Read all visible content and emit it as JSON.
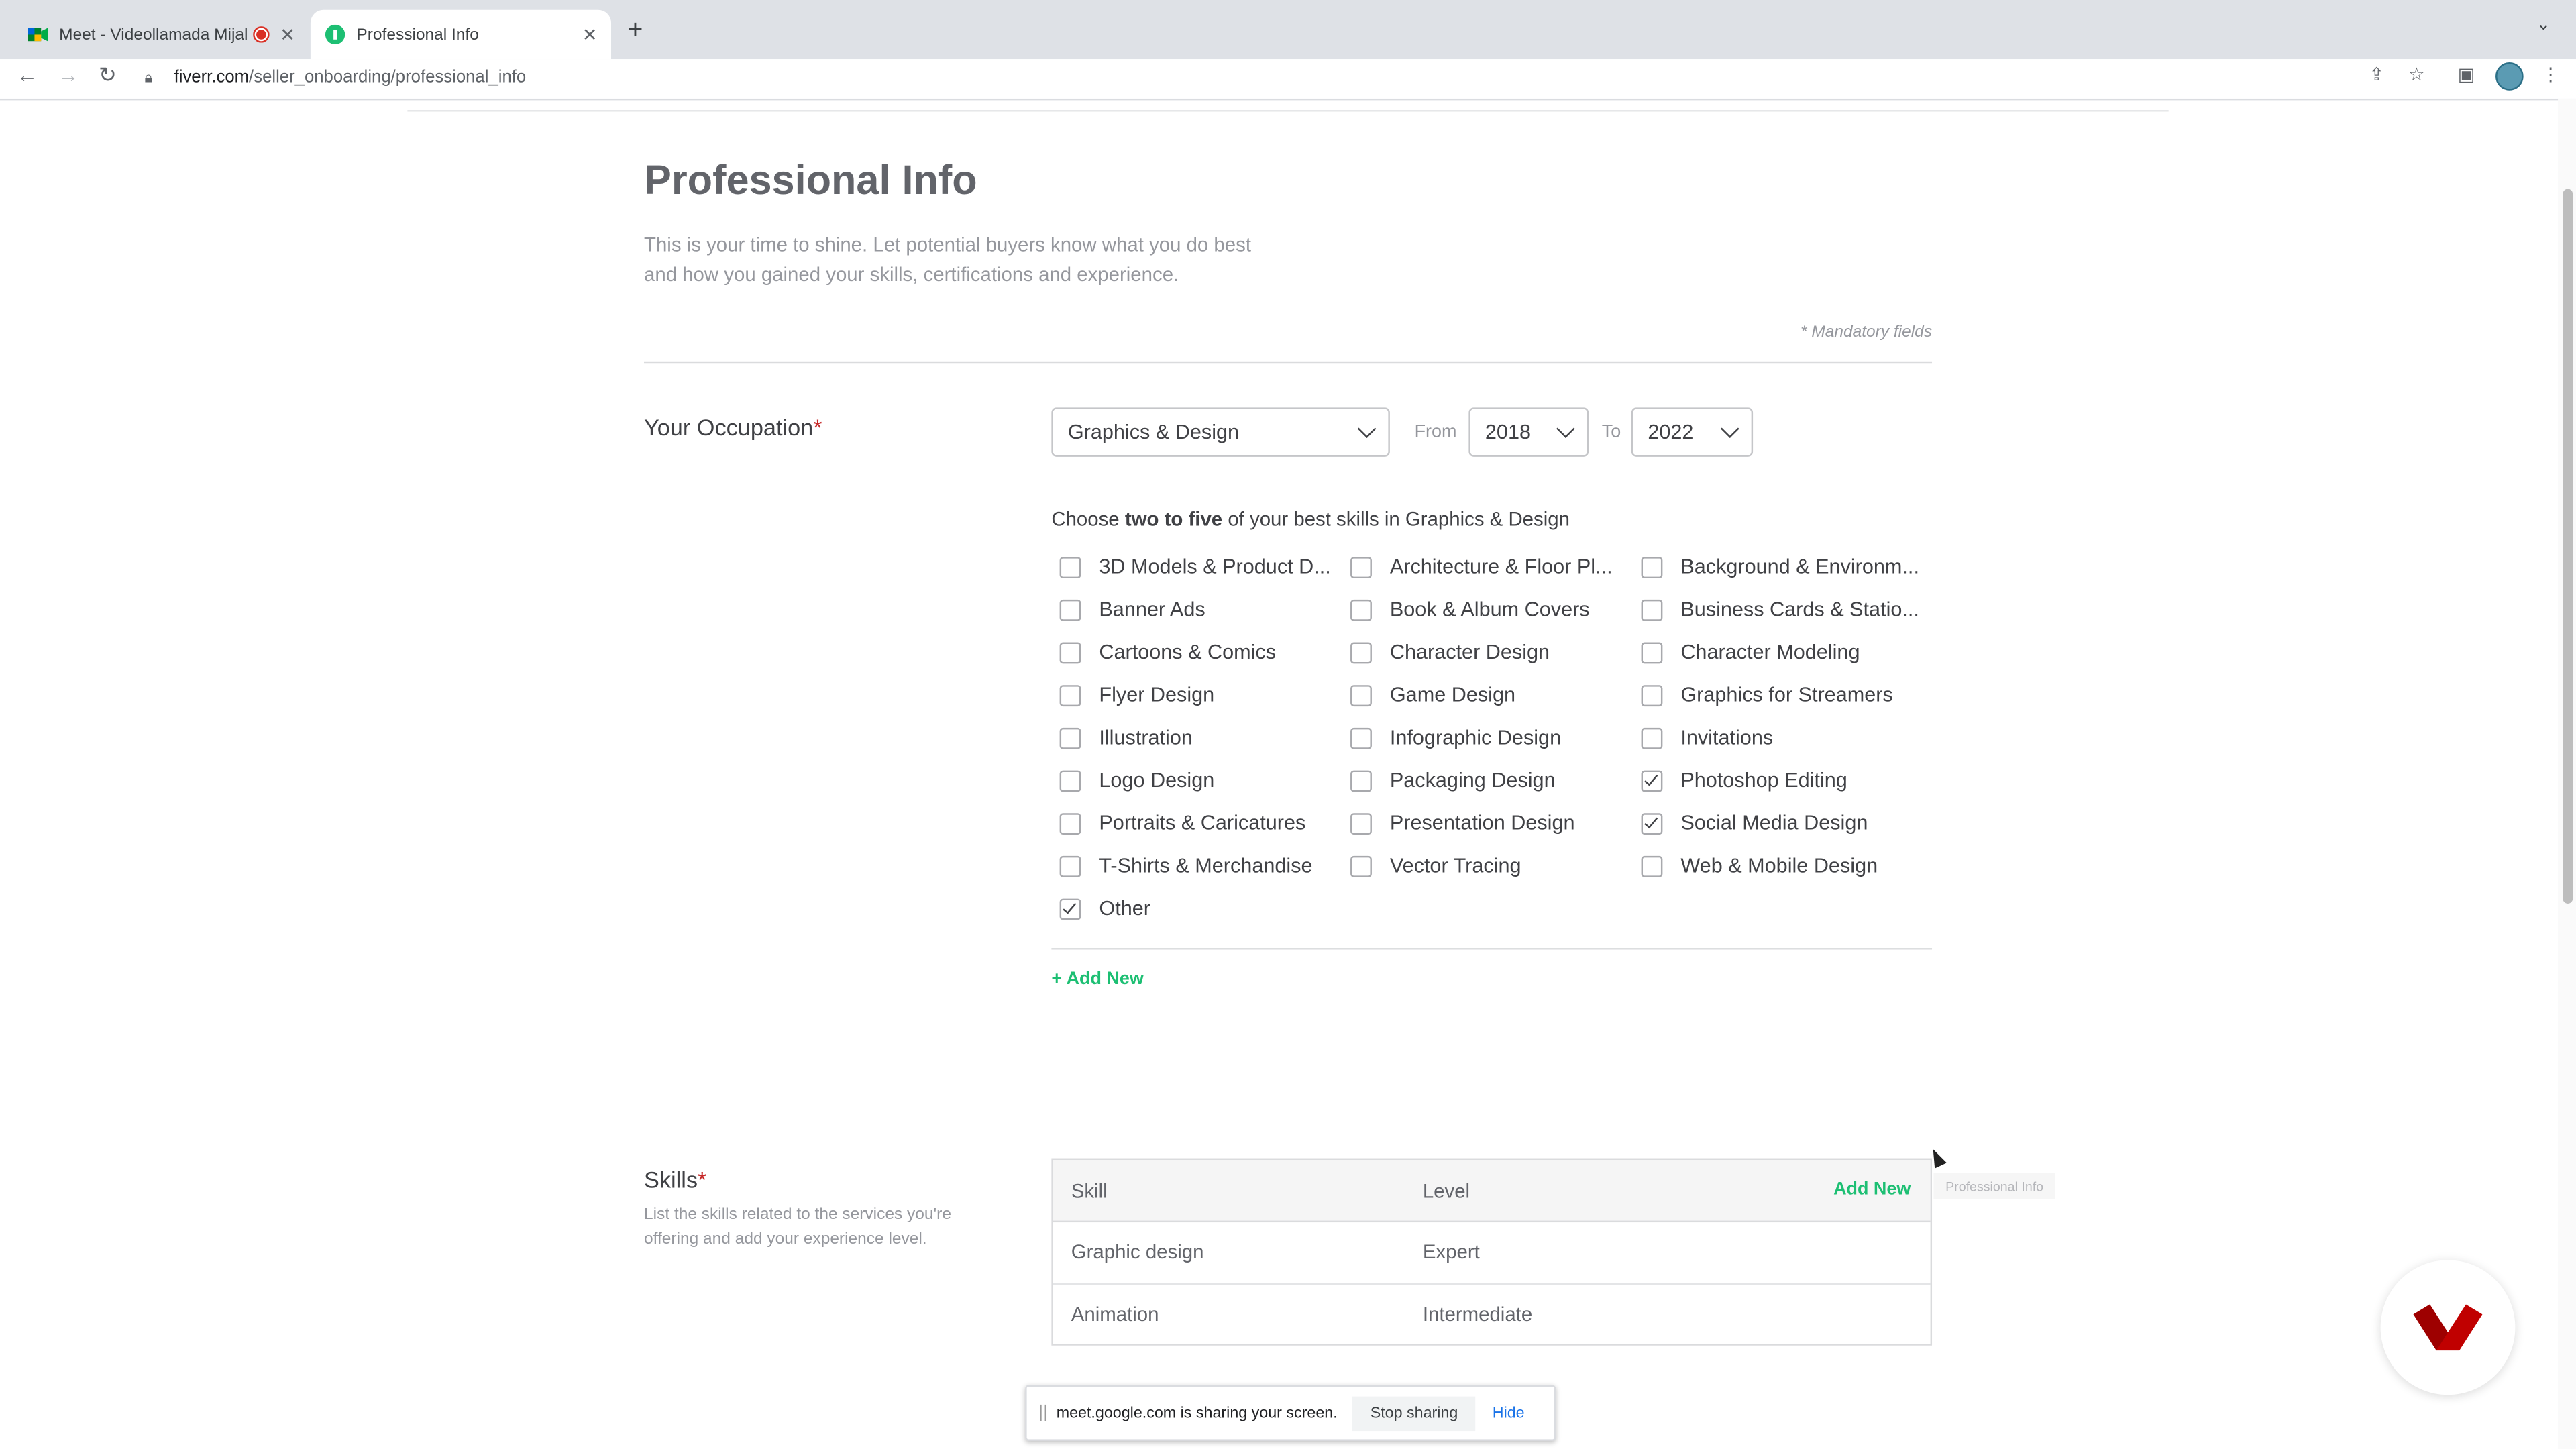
{
  "browser": {
    "tabs": [
      {
        "title": "Meet - Videollamada Mijal",
        "active": false
      },
      {
        "title": "Professional Info",
        "active": true
      }
    ],
    "url_host": "fiverr.com",
    "url_path": "/seller_onboarding/professional_info"
  },
  "page": {
    "title": "Professional Info",
    "intro": "This is your time to shine. Let potential buyers know what you do best and how you gained your skills, certifications and experience.",
    "mandatory_note": "* Mandatory fields"
  },
  "occupation": {
    "label": "Your Occupation",
    "required_mark": "*",
    "selected": "Graphics & Design",
    "from_label": "From",
    "from_value": "2018",
    "to_label": "To",
    "to_value": "2022",
    "choose_prefix": "Choose ",
    "choose_bold": "two to five",
    "choose_suffix": " of your best skills in Graphics & Design",
    "options": [
      {
        "label": "3D Models & Product D...",
        "checked": false
      },
      {
        "label": "Architecture & Floor Pl...",
        "checked": false
      },
      {
        "label": "Background & Environm...",
        "checked": false
      },
      {
        "label": "Banner Ads",
        "checked": false
      },
      {
        "label": "Book & Album Covers",
        "checked": false
      },
      {
        "label": "Business Cards & Statio...",
        "checked": false
      },
      {
        "label": "Cartoons & Comics",
        "checked": false
      },
      {
        "label": "Character Design",
        "checked": false
      },
      {
        "label": "Character Modeling",
        "checked": false
      },
      {
        "label": "Flyer Design",
        "checked": false
      },
      {
        "label": "Game Design",
        "checked": false
      },
      {
        "label": "Graphics for Streamers",
        "checked": false
      },
      {
        "label": "Illustration",
        "checked": false
      },
      {
        "label": "Infographic Design",
        "checked": false
      },
      {
        "label": "Invitations",
        "checked": false
      },
      {
        "label": "Logo Design",
        "checked": false
      },
      {
        "label": "Packaging Design",
        "checked": false
      },
      {
        "label": "Photoshop Editing",
        "checked": true
      },
      {
        "label": "Portraits & Caricatures",
        "checked": false
      },
      {
        "label": "Presentation Design",
        "checked": false
      },
      {
        "label": "Social Media Design",
        "checked": true
      },
      {
        "label": "T-Shirts & Merchandise",
        "checked": false
      },
      {
        "label": "Vector Tracing",
        "checked": false
      },
      {
        "label": "Web & Mobile Design",
        "checked": false
      },
      {
        "label": "Other",
        "checked": true
      }
    ],
    "add_new": "+ Add New"
  },
  "skills": {
    "label": "Skills",
    "required_mark": "*",
    "description": "List the skills related to the services you're offering and add your experience level.",
    "col_skill": "Skill",
    "col_level": "Level",
    "add_new": "Add New",
    "rows": [
      {
        "skill": "Graphic design",
        "level": "Expert"
      },
      {
        "skill": "Animation",
        "level": "Intermediate"
      }
    ],
    "tooltip": "Professional Info"
  },
  "sharebar": {
    "message": "meet.google.com is sharing your screen.",
    "stop": "Stop sharing",
    "hide": "Hide"
  },
  "colors": {
    "accent": "#1dbf73",
    "required": "#c62828",
    "logo": "#c00000"
  }
}
